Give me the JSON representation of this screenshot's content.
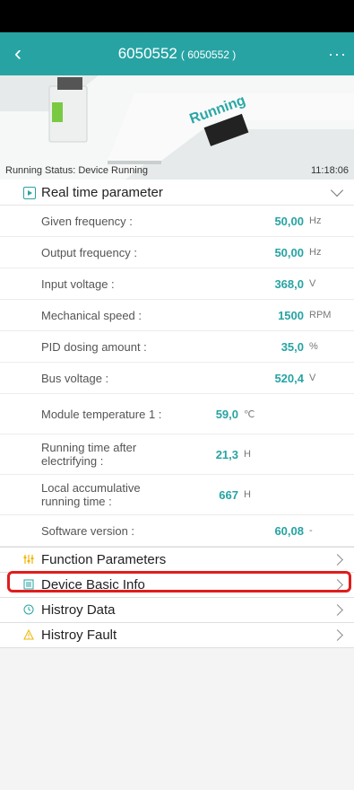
{
  "header": {
    "title": "6050552",
    "subtitle": "( 6050552 )",
    "more": "···"
  },
  "hero": {
    "banner": "Running",
    "status_text": "Running Status:  Device Running",
    "time": "11:18:06"
  },
  "realtime": {
    "title": "Real time parameter",
    "rows": [
      {
        "label": "Given frequency :",
        "value": "50,00",
        "unit": "Hz"
      },
      {
        "label": "Output frequency :",
        "value": "50,00",
        "unit": "Hz"
      },
      {
        "label": "Input voltage :",
        "value": "368,0",
        "unit": "V"
      },
      {
        "label": "Mechanical speed :",
        "value": "1500",
        "unit": "RPM"
      },
      {
        "label": "PID dosing amount :",
        "value": "35,0",
        "unit": "%"
      },
      {
        "label": "Bus voltage :",
        "value": "520,4",
        "unit": "V"
      },
      {
        "label": "Module temperature 1 :",
        "value": "59,0",
        "unit": "℃"
      },
      {
        "label": "Running time after electrifying :",
        "value": "21,3",
        "unit": "H"
      },
      {
        "label": "Local accumulative running time :",
        "value": "667",
        "unit": "H"
      },
      {
        "label": "Software version :",
        "value": "60,08",
        "unit": "-"
      }
    ]
  },
  "nav": [
    {
      "label": "Function Parameters",
      "icon": "sliders-icon"
    },
    {
      "label": "Device Basic Info",
      "icon": "document-icon"
    },
    {
      "label": "Histroy Data",
      "icon": "clock-icon"
    },
    {
      "label": "Histroy Fault",
      "icon": "warning-icon"
    }
  ],
  "colors": {
    "accent": "#27a3a3",
    "highlight": "#e01d1d",
    "warning": "#f0b400"
  }
}
